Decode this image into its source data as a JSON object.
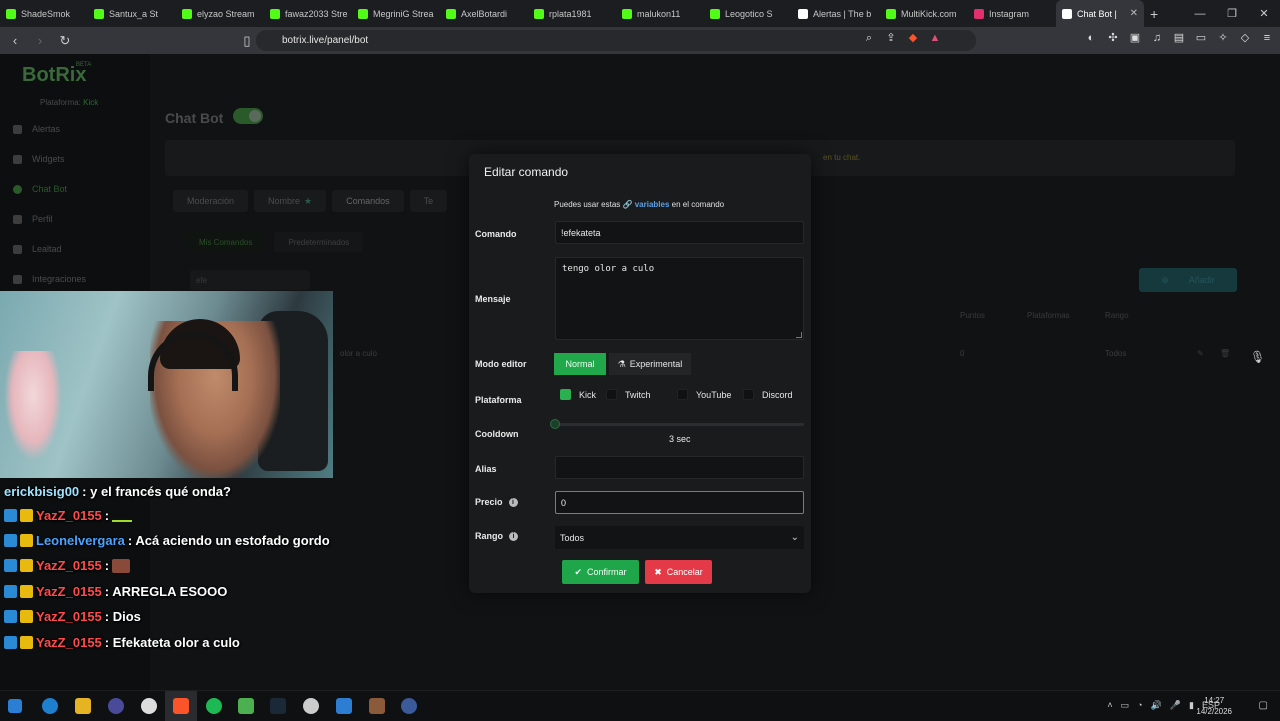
{
  "browser": {
    "tabs": [
      {
        "label": "ShadeSmok",
        "color": "#53fc18"
      },
      {
        "label": "Santux_a St",
        "color": "#53fc18"
      },
      {
        "label": "elyzao Stream",
        "color": "#53fc18"
      },
      {
        "label": "fawaz2033 Stre",
        "color": "#53fc18"
      },
      {
        "label": "MegriniG Strea",
        "color": "#53fc18"
      },
      {
        "label": "AxelBotardi",
        "color": "#53fc18"
      },
      {
        "label": "rplata1981",
        "color": "#53fc18"
      },
      {
        "label": "malukon11",
        "color": "#53fc18"
      },
      {
        "label": "Leogotico S",
        "color": "#53fc18"
      },
      {
        "label": "Alertas | The b",
        "color": "#ffffff"
      },
      {
        "label": "MultiKick.com",
        "color": "#53fc18"
      },
      {
        "label": "Instagram",
        "color": "#e1306c"
      },
      {
        "label": "Chat Bot |",
        "color": "#ffffff"
      }
    ],
    "url": "botrix.live/panel/bot"
  },
  "sidebar": {
    "logo": "BotRix",
    "beta": "BETA",
    "platform_label": "Plataforma:",
    "platform_value": "Kick",
    "items": [
      {
        "label": "Alertas"
      },
      {
        "label": "Widgets"
      },
      {
        "label": "Chat Bot"
      },
      {
        "label": "Perfil"
      },
      {
        "label": "Lealtad"
      },
      {
        "label": "Integraciones"
      }
    ]
  },
  "main": {
    "title": "Chat Bot",
    "banner_text": "en tu chat.",
    "tabs": [
      {
        "label": "Moderación"
      },
      {
        "label": "Nombre"
      },
      {
        "label": "Comandos"
      },
      {
        "label": "Te"
      }
    ],
    "subtabs": [
      {
        "label": "Mis Comandos"
      },
      {
        "label": "Predeterminados"
      }
    ],
    "search_value": "efe",
    "add_label": "Añadir",
    "table": {
      "headers": [
        "Puntos",
        "Plataformas",
        "Rango"
      ],
      "row": {
        "name": "olor a culo",
        "points": "0",
        "rank": "Todos"
      }
    }
  },
  "modal": {
    "title": "Editar comando",
    "hint_prefix": "Puedes usar estas",
    "hint_link": "variables",
    "hint_suffix": "en el comando",
    "labels": {
      "command": "Comando",
      "message": "Mensaje",
      "mode": "Modo editor",
      "platform": "Plataforma",
      "cooldown": "Cooldown",
      "alias": "Alias",
      "price": "Precio",
      "rank": "Rango"
    },
    "command_value": "!efekateta",
    "message_value": "tengo olor a culo",
    "mode_normal": "Normal",
    "mode_experimental": "Experimental",
    "platforms": [
      {
        "label": "Kick",
        "checked": true
      },
      {
        "label": "Twitch",
        "checked": false
      },
      {
        "label": "YouTube",
        "checked": false
      },
      {
        "label": "Discord",
        "checked": false
      }
    ],
    "cooldown_value": "3 sec",
    "cooldown_fraction": 0,
    "alias_value": "",
    "price_value": "0",
    "rank_value": "Todos",
    "confirm_label": "Confirmar",
    "cancel_label": "Cancelar"
  },
  "chat": [
    {
      "user": "erickbisig00",
      "user_color": "#9fe3ff",
      "text": ": y el francés qué onda?",
      "badges": false
    },
    {
      "user": "YazZ_0155",
      "user_color": "#ff4b4b",
      "text": ":",
      "badges": true,
      "emote": "green-line"
    },
    {
      "user": "Leonelvergara",
      "user_color": "#4aa3ff",
      "text": ": Acá aciendo un estofado gordo",
      "badges": true
    },
    {
      "user": "YazZ_0155",
      "user_color": "#ff4b4b",
      "text": ":",
      "badges": true,
      "emote": "image"
    },
    {
      "user": "YazZ_0155",
      "user_color": "#ff4b4b",
      "text": ": ARREGLA ESOOO",
      "badges": true
    },
    {
      "user": "YazZ_0155",
      "user_color": "#ff4b4b",
      "text": ": Dios",
      "badges": true
    },
    {
      "user": "YazZ_0155",
      "user_color": "#ff4b4b",
      "text": ": Efekateta olor a culo",
      "badges": true
    }
  ],
  "taskbar": {
    "lang": "ESP",
    "time": "14:27",
    "date": "14/2/2026"
  }
}
